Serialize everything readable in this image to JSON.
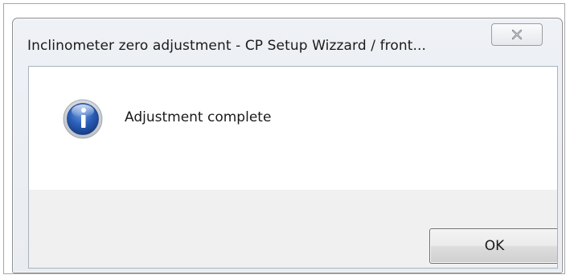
{
  "dialog": {
    "title": "Inclinometer zero adjustment - CP Setup Wizzard / front...",
    "close_icon": "close-icon",
    "message_icon": "info-icon",
    "message": "Adjustment complete",
    "ok_label": "OK"
  },
  "colors": {
    "icon_blue": "#2b5fb8",
    "icon_ring": "#c9ccd3",
    "close_glyph": "#5f6772"
  }
}
